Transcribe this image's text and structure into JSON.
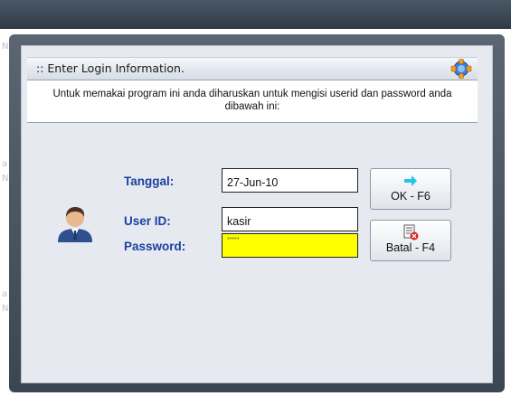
{
  "header": {
    "title": ":: Enter Login Information.",
    "icon": "network-node-icon"
  },
  "instructions": "Untuk memakai program ini anda diharuskan untuk mengisi userid dan password anda dibawah ini:",
  "form": {
    "date_label": "Tanggal:",
    "date_value": "27-Jun-10",
    "userid_label": "User ID:",
    "userid_value": "kasir",
    "password_label": "Password:",
    "password_value": "*****"
  },
  "buttons": {
    "ok_label": "OK - F6",
    "ok_icon": "arrow-right-icon",
    "cancel_label": "Batal - F4",
    "cancel_icon": "document-cancel-icon"
  },
  "colors": {
    "label_blue": "#1b3fa0",
    "password_bg": "#ffff00",
    "frame_dark": "#3c4652"
  }
}
